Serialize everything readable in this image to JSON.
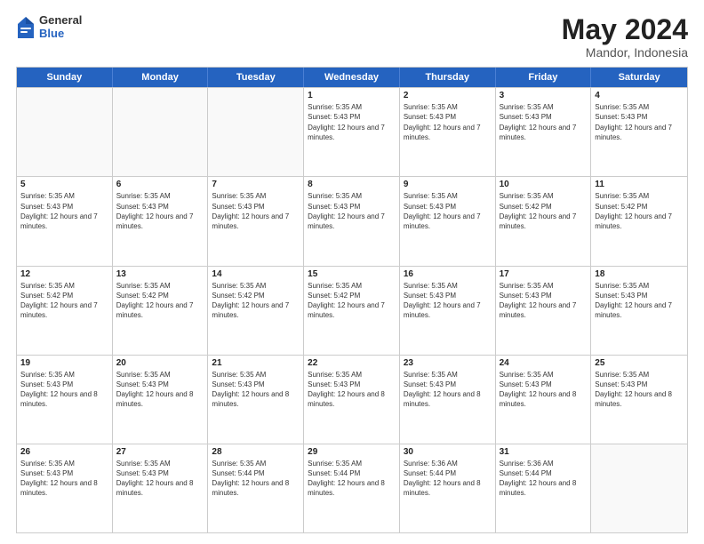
{
  "logo": {
    "general": "General",
    "blue": "Blue"
  },
  "title": {
    "month": "May 2024",
    "location": "Mandor, Indonesia"
  },
  "header_days": [
    "Sunday",
    "Monday",
    "Tuesday",
    "Wednesday",
    "Thursday",
    "Friday",
    "Saturday"
  ],
  "weeks": [
    [
      {
        "day": "",
        "empty": true
      },
      {
        "day": "",
        "empty": true
      },
      {
        "day": "",
        "empty": true
      },
      {
        "day": "1",
        "sunrise": "5:35 AM",
        "sunset": "5:43 PM",
        "daylight": "12 hours and 7 minutes."
      },
      {
        "day": "2",
        "sunrise": "5:35 AM",
        "sunset": "5:43 PM",
        "daylight": "12 hours and 7 minutes."
      },
      {
        "day": "3",
        "sunrise": "5:35 AM",
        "sunset": "5:43 PM",
        "daylight": "12 hours and 7 minutes."
      },
      {
        "day": "4",
        "sunrise": "5:35 AM",
        "sunset": "5:43 PM",
        "daylight": "12 hours and 7 minutes."
      }
    ],
    [
      {
        "day": "5",
        "sunrise": "5:35 AM",
        "sunset": "5:43 PM",
        "daylight": "12 hours and 7 minutes."
      },
      {
        "day": "6",
        "sunrise": "5:35 AM",
        "sunset": "5:43 PM",
        "daylight": "12 hours and 7 minutes."
      },
      {
        "day": "7",
        "sunrise": "5:35 AM",
        "sunset": "5:43 PM",
        "daylight": "12 hours and 7 minutes."
      },
      {
        "day": "8",
        "sunrise": "5:35 AM",
        "sunset": "5:43 PM",
        "daylight": "12 hours and 7 minutes."
      },
      {
        "day": "9",
        "sunrise": "5:35 AM",
        "sunset": "5:43 PM",
        "daylight": "12 hours and 7 minutes."
      },
      {
        "day": "10",
        "sunrise": "5:35 AM",
        "sunset": "5:42 PM",
        "daylight": "12 hours and 7 minutes."
      },
      {
        "day": "11",
        "sunrise": "5:35 AM",
        "sunset": "5:42 PM",
        "daylight": "12 hours and 7 minutes."
      }
    ],
    [
      {
        "day": "12",
        "sunrise": "5:35 AM",
        "sunset": "5:42 PM",
        "daylight": "12 hours and 7 minutes."
      },
      {
        "day": "13",
        "sunrise": "5:35 AM",
        "sunset": "5:42 PM",
        "daylight": "12 hours and 7 minutes."
      },
      {
        "day": "14",
        "sunrise": "5:35 AM",
        "sunset": "5:42 PM",
        "daylight": "12 hours and 7 minutes."
      },
      {
        "day": "15",
        "sunrise": "5:35 AM",
        "sunset": "5:42 PM",
        "daylight": "12 hours and 7 minutes."
      },
      {
        "day": "16",
        "sunrise": "5:35 AM",
        "sunset": "5:43 PM",
        "daylight": "12 hours and 7 minutes."
      },
      {
        "day": "17",
        "sunrise": "5:35 AM",
        "sunset": "5:43 PM",
        "daylight": "12 hours and 7 minutes."
      },
      {
        "day": "18",
        "sunrise": "5:35 AM",
        "sunset": "5:43 PM",
        "daylight": "12 hours and 7 minutes."
      }
    ],
    [
      {
        "day": "19",
        "sunrise": "5:35 AM",
        "sunset": "5:43 PM",
        "daylight": "12 hours and 8 minutes."
      },
      {
        "day": "20",
        "sunrise": "5:35 AM",
        "sunset": "5:43 PM",
        "daylight": "12 hours and 8 minutes."
      },
      {
        "day": "21",
        "sunrise": "5:35 AM",
        "sunset": "5:43 PM",
        "daylight": "12 hours and 8 minutes."
      },
      {
        "day": "22",
        "sunrise": "5:35 AM",
        "sunset": "5:43 PM",
        "daylight": "12 hours and 8 minutes."
      },
      {
        "day": "23",
        "sunrise": "5:35 AM",
        "sunset": "5:43 PM",
        "daylight": "12 hours and 8 minutes."
      },
      {
        "day": "24",
        "sunrise": "5:35 AM",
        "sunset": "5:43 PM",
        "daylight": "12 hours and 8 minutes."
      },
      {
        "day": "25",
        "sunrise": "5:35 AM",
        "sunset": "5:43 PM",
        "daylight": "12 hours and 8 minutes."
      }
    ],
    [
      {
        "day": "26",
        "sunrise": "5:35 AM",
        "sunset": "5:43 PM",
        "daylight": "12 hours and 8 minutes."
      },
      {
        "day": "27",
        "sunrise": "5:35 AM",
        "sunset": "5:43 PM",
        "daylight": "12 hours and 8 minutes."
      },
      {
        "day": "28",
        "sunrise": "5:35 AM",
        "sunset": "5:44 PM",
        "daylight": "12 hours and 8 minutes."
      },
      {
        "day": "29",
        "sunrise": "5:35 AM",
        "sunset": "5:44 PM",
        "daylight": "12 hours and 8 minutes."
      },
      {
        "day": "30",
        "sunrise": "5:36 AM",
        "sunset": "5:44 PM",
        "daylight": "12 hours and 8 minutes."
      },
      {
        "day": "31",
        "sunrise": "5:36 AM",
        "sunset": "5:44 PM",
        "daylight": "12 hours and 8 minutes."
      },
      {
        "day": "",
        "empty": true
      }
    ]
  ]
}
